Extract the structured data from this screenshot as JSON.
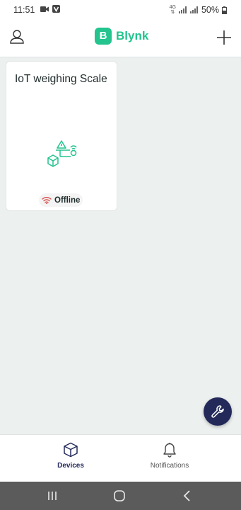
{
  "status_bar": {
    "time": "11:51",
    "battery": "50%",
    "network_type": "4G",
    "left_icons": [
      "video-camera-icon",
      "v-app-icon"
    ],
    "right_icons": [
      "data-arrows-icon",
      "signal-icon",
      "signal-icon",
      "battery-icon"
    ]
  },
  "header": {
    "logo_mark": "B",
    "logo_text": "Blynk",
    "profile_icon": "user-icon",
    "add_icon": "plus-icon"
  },
  "device_card": {
    "title": "IoT weighing Scale",
    "status": "Offline",
    "status_icon": "wifi-off-icon",
    "image_icon": "iot-device-icon"
  },
  "fab": {
    "icon": "wrench-icon"
  },
  "bottom_nav": {
    "items": [
      {
        "label": "Devices",
        "icon": "cube-icon",
        "active": true
      },
      {
        "label": "Notifications",
        "icon": "bell-icon",
        "active": false
      }
    ]
  },
  "colors": {
    "brand": "#23c48e",
    "nav_active": "#232a5a",
    "background": "#ecf0ef",
    "offline": "#d9534f"
  }
}
